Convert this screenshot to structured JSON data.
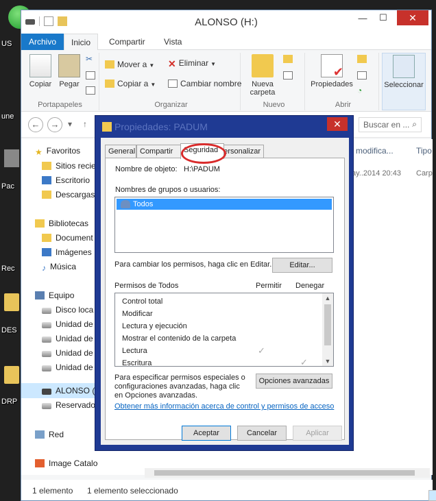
{
  "desktop": {
    "labels": [
      "US",
      "une",
      "Pac",
      "Rec",
      "DES",
      "DRP"
    ]
  },
  "window": {
    "title": "ALONSO (H:)",
    "min": "—",
    "max": "☐",
    "close": "✕"
  },
  "ribbon_tabs": [
    "Archivo",
    "Inicio",
    "Compartir",
    "Vista"
  ],
  "ribbon": {
    "copiar": "Copiar",
    "pegar": "Pegar",
    "portapapeles": "Portapapeles",
    "mover_a": "Mover a",
    "copiar_a": "Copiar a",
    "eliminar": "Eliminar",
    "cambiar_nombre": "Cambiar nombre",
    "organizar": "Organizar",
    "nueva_carpeta_1": "Nueva",
    "nueva_carpeta_2": "carpeta",
    "nuevo": "Nuevo",
    "propiedades": "Propiedades",
    "abrir": "Abrir",
    "seleccionar": "Seleccionar"
  },
  "address": {
    "back": "←",
    "forward": "→",
    "recent": "▾",
    "up": "↑",
    "search": "Buscar en ..."
  },
  "nav": {
    "favoritos": "Favoritos",
    "sitios": "Sitios recie",
    "escritorio": "Escritorio",
    "descargas": "Descargas",
    "bibliotecas": "Bibliotecas",
    "documentos": "Document",
    "imagenes": "Imágenes",
    "musica": "Música",
    "equipo": "Equipo",
    "disco": "Disco loca",
    "unidad1": "Unidad de",
    "unidad2": "Unidad de",
    "unidad3": "Unidad de",
    "unidad4": "Unidad de",
    "alonso": "ALONSO (",
    "reservado": "Reservado",
    "red": "Red",
    "image_catalog": "Image Catalog"
  },
  "list": {
    "col_fecha": "e modifica...",
    "col_tipo": "Tipo",
    "row_fecha": "ay..2014 20:43",
    "row_tipo": "Carp"
  },
  "status": {
    "count": "1 elemento",
    "selected": "1 elemento seleccionado"
  },
  "dialog": {
    "title": "Propiedades: PADUM",
    "close": "✕",
    "tabs": [
      "General",
      "Compartir",
      "Seguridad",
      "Personalizar"
    ],
    "nombre_objeto_label": "Nombre de objeto:",
    "nombre_objeto_value": "H:\\PADUM",
    "grupos_label": "Nombres de grupos o usuarios:",
    "grupo_item": "Todos",
    "cambiar_permisos": "Para cambiar los permisos, haga clic en Editar.",
    "editar": "Editar...",
    "permisos_de": "Permisos de Todos",
    "permitir": "Permitir",
    "denegar": "Denegar",
    "permisos": [
      "Control total",
      "Modificar",
      "Lectura y ejecución",
      "Mostrar el contenido de la carpeta",
      "Lectura",
      "Escritura"
    ],
    "check": "✓",
    "especiales_1": "Para especificar permisos especiales o",
    "especiales_2": "configuraciones avanzadas, haga clic",
    "especiales_3": "en Opciones avanzadas.",
    "opciones_avanzadas": "Opciones avanzadas",
    "link": "Obtener más información acerca de control y permisos de acceso",
    "aceptar": "Aceptar",
    "cancelar": "Cancelar",
    "aplicar": "Aplicar"
  }
}
